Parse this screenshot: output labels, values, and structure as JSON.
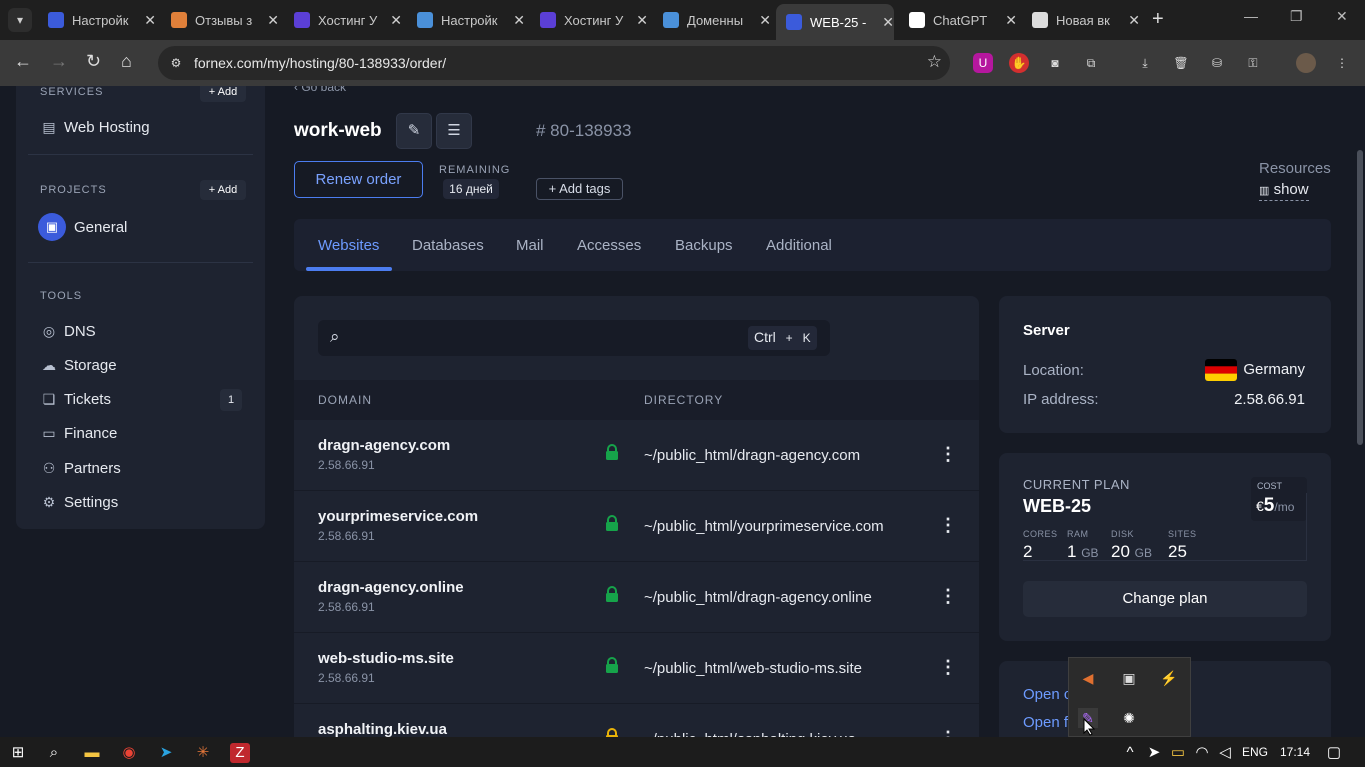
{
  "browser": {
    "tabs": [
      {
        "title": "Настройк",
        "favicon": "fornex-icon",
        "color": "#3b5bdb"
      },
      {
        "title": "Отзывы з",
        "favicon": "review-icon",
        "color": "#e0803a"
      },
      {
        "title": "Хостинг У",
        "favicon": "ua-icon",
        "color": "#5b3fd6"
      },
      {
        "title": "Настройк",
        "favicon": "settings-icon",
        "color": "#4a90d9"
      },
      {
        "title": "Хостинг У",
        "favicon": "ua-icon",
        "color": "#5b3fd6"
      },
      {
        "title": "Доменны",
        "favicon": "settings-icon",
        "color": "#4a90d9"
      },
      {
        "title": "WEB-25 -",
        "favicon": "fornex-icon",
        "color": "#3b5bdb"
      },
      {
        "title": "ChatGPT",
        "favicon": "chatgpt-icon",
        "color": "#ffffff"
      },
      {
        "title": "Новая вк",
        "favicon": "chrome-icon",
        "color": "#dddddd"
      }
    ],
    "url": "fornex.com/my/hosting/80-138933/order/"
  },
  "sidebar": {
    "services_title": "SERVICES",
    "services_add": "+ Add",
    "web_hosting": "Web Hosting",
    "projects_title": "PROJECTS",
    "projects_add": "+ Add",
    "general": "General",
    "tools_title": "TOOLS",
    "tools": [
      {
        "label": "DNS",
        "icon": "globe-icon"
      },
      {
        "label": "Storage",
        "icon": "cloud-icon"
      },
      {
        "label": "Tickets",
        "icon": "chat-icon",
        "badge": "1"
      },
      {
        "label": "Finance",
        "icon": "card-icon"
      },
      {
        "label": "Partners",
        "icon": "users-icon"
      },
      {
        "label": "Settings",
        "icon": "gear-icon"
      }
    ]
  },
  "header": {
    "back": "Go back",
    "order_name": "work-web",
    "order_id": "# 80-138933",
    "renew": "Renew order",
    "remaining_label": "REMAINING",
    "remaining_value": "16 дней",
    "add_tags": "+ Add tags",
    "resources_label": "Resources",
    "resources_show": "show"
  },
  "tabs": [
    "Websites",
    "Databases",
    "Mail",
    "Accesses",
    "Backups",
    "Additional"
  ],
  "domains": {
    "search_shortcut_1": "Ctrl",
    "search_shortcut_plus": "+",
    "search_shortcut_2": "K",
    "col_domain": "DOMAIN",
    "col_directory": "DIRECTORY",
    "rows": [
      {
        "domain": "dragn-agency.com",
        "ip": "2.58.66.91",
        "dir": "~/public_html/dragn-agency.com",
        "lock": "#16a34a"
      },
      {
        "domain": "yourprimeservice.com",
        "ip": "2.58.66.91",
        "dir": "~/public_html/yourprimeservice.com",
        "lock": "#16a34a"
      },
      {
        "domain": "dragn-agency.online",
        "ip": "2.58.66.91",
        "dir": "~/public_html/dragn-agency.online",
        "lock": "#16a34a"
      },
      {
        "domain": "web-studio-ms.site",
        "ip": "2.58.66.91",
        "dir": "~/public_html/web-studio-ms.site",
        "lock": "#16a34a"
      },
      {
        "domain": "asphalting.kiev.ua",
        "ip": "",
        "dir": "~/public_html/asphalting.kiev.ua",
        "lock": "#eab308"
      }
    ]
  },
  "server": {
    "title": "Server",
    "location_label": "Location:",
    "location_value": "Germany",
    "ip_label": "IP address:",
    "ip_value": "2.58.66.91"
  },
  "plan": {
    "label": "CURRENT PLAN",
    "name": "WEB-25",
    "cost_label": "COST",
    "cost_currency": "€",
    "cost_value": "5",
    "cost_period": "/mo",
    "specs": [
      {
        "label": "CORES",
        "value": "2",
        "unit": ""
      },
      {
        "label": "RAM",
        "value": "1",
        "unit": "GB"
      },
      {
        "label": "DISK",
        "value": "20",
        "unit": "GB"
      },
      {
        "label": "SITES",
        "value": "25",
        "unit": ""
      }
    ],
    "change": "Change plan"
  },
  "links": {
    "open_1": "Open c",
    "open_2": "Open f"
  },
  "taskbar": {
    "lang": "ENG",
    "time": "17:14"
  }
}
